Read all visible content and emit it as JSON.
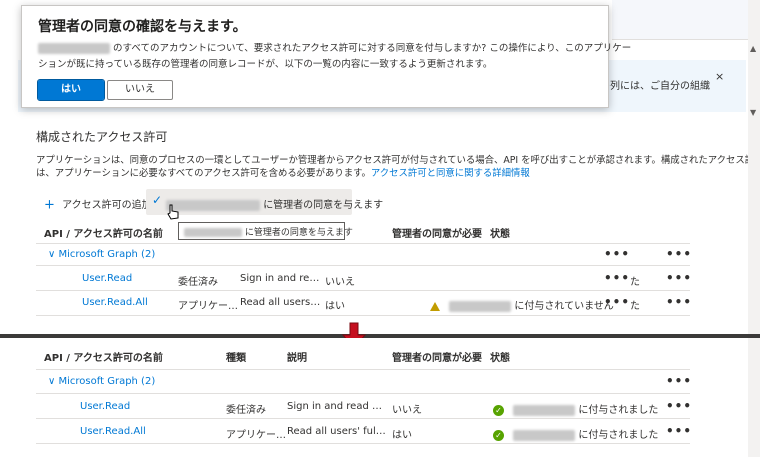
{
  "dialog": {
    "title": "管理者の同意の確認を与えます。",
    "line1": "のすべてのアカウントについて、要求されたアクセス許可に対する同意を付与しますか? この操作により、このアプリケー",
    "line2": "ションが既に持っている既存の管理者の同意レコードが、以下の一覧の内容に一致するよう更新されます。",
    "yes": "はい",
    "no": "いいえ"
  },
  "banner": {
    "tail": "の列には、ご自分の組織",
    "close": "×"
  },
  "section": {
    "title": "構成されたアクセス許可",
    "desc1": "アプリケーションは、同意のプロセスの一環としてユーザーか管理者からアクセス許可が付与されている場合、API を呼び出すことが承認されます。構成されたアクセス許可の一覧に",
    "desc2_text": "は、アプリケーションに必要なすべてのアクセス許可を含める必要があります。",
    "desc2_link": "アクセス許可と同意に関する詳細情報"
  },
  "toolbar": {
    "add_icon": "+",
    "add_label": "アクセス許可の追加",
    "grant_icon": "check-icon",
    "grant_label": "に管理者の同意を与えます",
    "tooltip": "に管理者の同意を与えます"
  },
  "table_top": {
    "headers": [
      "API / アクセス許可の名前",
      "管理者の同意が必要",
      "状態"
    ],
    "group": "Microsoft Graph (2)",
    "rows": [
      {
        "name": "User.Read",
        "type": "委任済み",
        "desc": "Sign in and re…",
        "admin": "いいえ",
        "status": ""
      },
      {
        "name": "User.Read.All",
        "type": "アプリケー…",
        "desc": "Read all users…",
        "admin": "はい",
        "status": "に付与されていません"
      }
    ],
    "cut_text": "た"
  },
  "table_bottom": {
    "headers": [
      "API / アクセス許可の名前",
      "種類",
      "説明",
      "管理者の同意が必要",
      "状態"
    ],
    "group": "Microsoft Graph (2)",
    "rows": [
      {
        "name": "User.Read",
        "type": "委任済み",
        "desc": "Sign in and read …",
        "admin": "いいえ",
        "status": "に付与されました"
      },
      {
        "name": "User.Read.All",
        "type": "アプリケー…",
        "desc": "Read all users' ful…",
        "admin": "はい",
        "status": "に付与されました"
      }
    ]
  },
  "more": "•••",
  "colors": {
    "accent": "#0078d4",
    "success": "#57a300",
    "warning": "#c19c00",
    "arrow": "#c50f1f"
  }
}
